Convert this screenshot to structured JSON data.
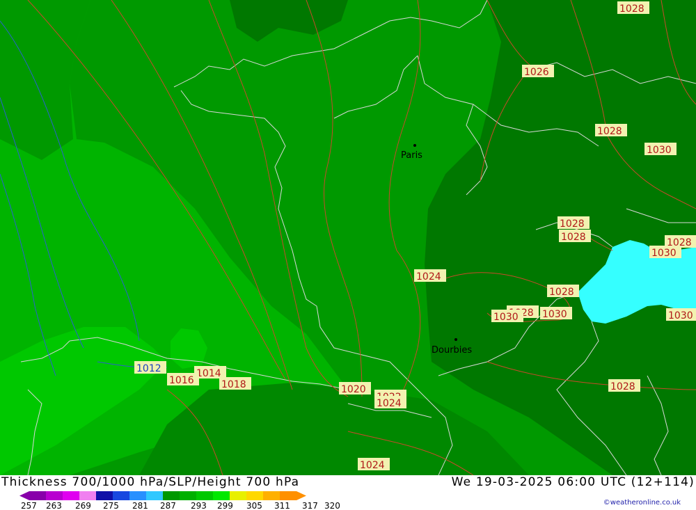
{
  "header": {
    "title": "Thickness 700/1000 hPa/SLP/Height 700 hPa",
    "datetime": "We 19-03-2025 06:00 UTC (12+114)",
    "copyright": "©weatheronline.co.uk"
  },
  "map": {
    "cities": [
      {
        "name": "Paris"
      },
      {
        "name": "Dourbies"
      }
    ],
    "isobar_labels": [
      "1028",
      "1026",
      "1028",
      "1030",
      "1028",
      "1028",
      "1028",
      "1030",
      "1024",
      "1028",
      "1028",
      "1030",
      "1030",
      "1030",
      "1012",
      "1014",
      "1016",
      "1018",
      "1020",
      "1022",
      "1024",
      "1028",
      "1024"
    ],
    "colors": {
      "thickness_dark": "#007800",
      "thickness_mid": "#009900",
      "thickness_light": "#00b400",
      "thickness_brightest": "#00c800",
      "sea": "#35ffff",
      "isobar": "#c84a2a",
      "coast": "#d8d8d8",
      "label_bg": "#f2f2b0",
      "label_text": "#b01818"
    }
  },
  "legend": {
    "ticks": [
      "257",
      "263",
      "269",
      "275",
      "281",
      "287",
      "293",
      "299",
      "305",
      "311",
      "317",
      "320"
    ],
    "colors": [
      "#8800aa",
      "#b800d0",
      "#e000f0",
      "#f080f0",
      "#1010a8",
      "#1848e0",
      "#2890ff",
      "#30c8ff",
      "#009800",
      "#00b000",
      "#00c800",
      "#00e800",
      "#e8f000",
      "#ffd800",
      "#ffb000",
      "#ff9000"
    ]
  }
}
